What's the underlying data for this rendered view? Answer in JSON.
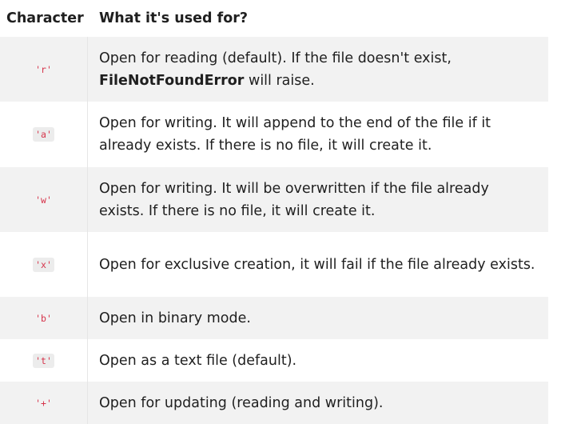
{
  "header": {
    "character": "Character",
    "description": "What it's used for?"
  },
  "rows": [
    {
      "char": "'r'",
      "text_before": "Open for reading (default). If the file doesn't exist,",
      "bold": "FileNotFoundError",
      "text_after": " will raise."
    },
    {
      "char": "'a'",
      "text": "Open for writing. It will append to the end of the file if it already exists. If there is no file, it will create it."
    },
    {
      "char": "'w'",
      "text": "Open for writing. It will be overwritten if the file already exists. If there is no file, it will create it."
    },
    {
      "char": "'x'",
      "text": "Open for exclusive creation, it will fail if the file already exists."
    },
    {
      "char": "'b'",
      "text": "Open in binary mode."
    },
    {
      "char": "'t'",
      "text": "Open as a text file (default)."
    },
    {
      "char": "'+'",
      "text": "Open for updating (reading and writing)."
    }
  ]
}
